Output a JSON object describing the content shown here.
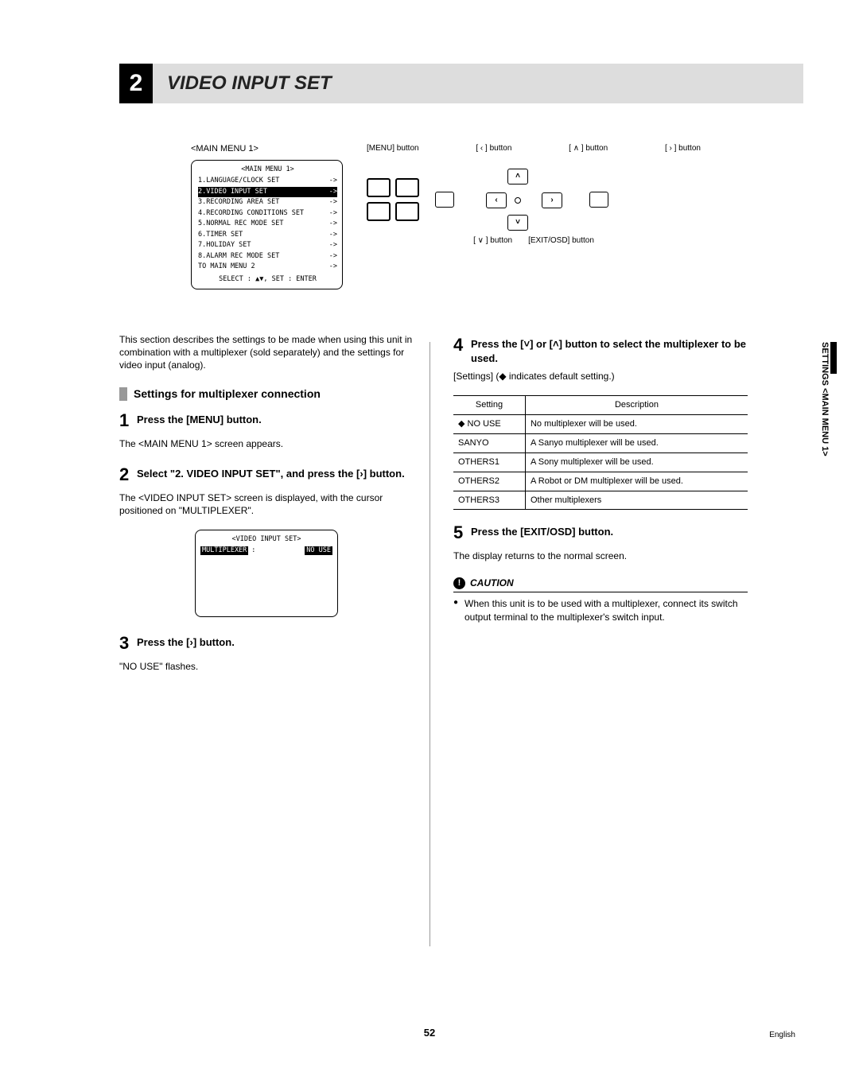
{
  "title": {
    "num": "2",
    "text": "VIDEO INPUT SET"
  },
  "menu_label": "<MAIN MENU 1>",
  "menu_screen": {
    "title": "<MAIN MENU 1>",
    "items": [
      "1.LANGUAGE/CLOCK SET",
      "2.VIDEO INPUT SET",
      "3.RECORDING AREA SET",
      "4.RECORDING CONDITIONS SET",
      "5.NORMAL REC MODE SET",
      "6.TIMER SET",
      "7.HOLIDAY SET",
      "8.ALARM REC MODE SET",
      "TO MAIN MENU 2"
    ],
    "footer": "SELECT : ▲▼,    SET : ENTER"
  },
  "panel_labels": {
    "menu": "[MENU] button",
    "left": "[ ‹ ] button",
    "up": "[ ∧ ] button",
    "right": "[ › ] button",
    "down": "[ ∨ ] button",
    "exit": "[EXIT/OSD] button"
  },
  "intro": "This section describes the settings to be made when using this unit in combination with a multiplexer (sold separately) and the settings for video input (analog).",
  "section_hdr": "Settings for multiplexer connection",
  "step1": {
    "title": "Press the [MENU] button.",
    "body": "The <MAIN MENU 1> screen appears."
  },
  "step2": {
    "title_a": "Select \"2. VIDEO INPUT SET\", and press the [",
    "title_b": "] button.",
    "body": "The <VIDEO INPUT SET> screen is displayed, with the cursor positioned on \"MULTIPLEXER\"."
  },
  "sub_screen": {
    "title": "<VIDEO INPUT SET>",
    "label": "MULTIPLEXER",
    "sep": ":",
    "value": "NO USE"
  },
  "step3": {
    "title_a": "Press the [",
    "title_b": "] button.",
    "body": "\"NO USE\" flashes."
  },
  "step4": {
    "title_a": "Press the [",
    "title_mid": "] or [",
    "title_b": "] button to select the multiplexer to be used."
  },
  "settings_caption": "[Settings] (◆ indicates default setting.)",
  "table": {
    "h1": "Setting",
    "h2": "Description",
    "rows": [
      {
        "s": "◆ NO USE",
        "d": "No multiplexer will be used."
      },
      {
        "s": "SANYO",
        "d": "A Sanyo multiplexer will be used."
      },
      {
        "s": "OTHERS1",
        "d": "A Sony multiplexer will be used."
      },
      {
        "s": "OTHERS2",
        "d": "A Robot or DM multiplexer will be used."
      },
      {
        "s": "OTHERS3",
        "d": "Other multiplexers"
      }
    ]
  },
  "step5": {
    "title": "Press the [EXIT/OSD] button.",
    "body": "The display returns to the normal screen."
  },
  "caution": {
    "label": "CAUTION",
    "body": "When this unit is to be used with a multiplexer, connect its switch output terminal to the multiplexer's switch input."
  },
  "side_text": "SETTINGS <MAIN MENU 1>",
  "page_num": "52",
  "lang": "English"
}
